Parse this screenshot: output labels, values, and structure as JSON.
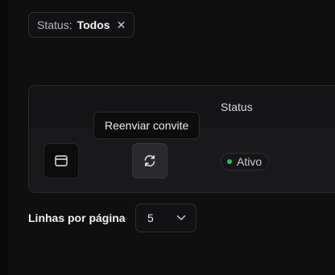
{
  "filter_chip": {
    "key": "Status:",
    "value": "Todos",
    "remove_glyph": "✕"
  },
  "table": {
    "columns": [
      "Status"
    ],
    "rows": [
      {
        "actions": [
          "browser-window-icon",
          "refresh-icon"
        ],
        "status": "Ativo",
        "status_color": "#22c55e"
      }
    ]
  },
  "tooltip": {
    "text": "Reenviar convite"
  },
  "pagination": {
    "rows_label": "Linhas por página",
    "rows_value": "5"
  },
  "colors": {
    "background": "#0f0f10",
    "card": "#141416",
    "active_dot": "#22c55e"
  }
}
